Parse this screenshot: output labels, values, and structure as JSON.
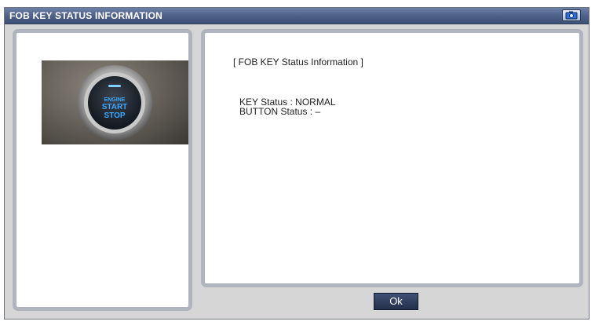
{
  "window": {
    "title": "FOB KEY STATUS INFORMATION",
    "camera_icon": "camera-icon"
  },
  "left_panel": {
    "image_icon": "start-stop-button-image",
    "button_text_top": "ENGINE",
    "button_text_1": "START",
    "button_text_2": "STOP"
  },
  "right_panel": {
    "heading": "[ FOB KEY Status Information ]",
    "key_status_label": "KEY Status : NORMAL",
    "button_status_label": "BUTTON Status : –"
  },
  "footer": {
    "ok_label": "Ok"
  }
}
